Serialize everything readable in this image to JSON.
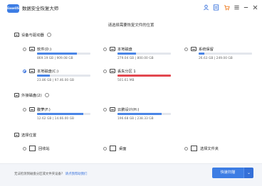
{
  "app": {
    "logo_text": "EaseUS",
    "title": "数据安全恢复大师"
  },
  "titlebar_icons": [
    {
      "name": "user-icon",
      "glyph": "👤",
      "color": "#3b74dd"
    },
    {
      "name": "document-icon",
      "glyph": "▣",
      "color": "#3b74dd"
    },
    {
      "name": "cart-icon",
      "glyph": "⊕",
      "color": "#ef7d22"
    },
    {
      "name": "menu-icon",
      "glyph": "≡",
      "color": "#444"
    },
    {
      "name": "minimize-icon",
      "glyph": "—",
      "color": "#444"
    },
    {
      "name": "close-icon",
      "glyph": "✕",
      "color": "#444"
    }
  ],
  "heading": "请选择需要恢复文件的位置",
  "sections": {
    "local": "设备与驱动器",
    "external": "外接磁盘(2)",
    "location": "选择位置"
  },
  "local_drives": [
    {
      "name": "软件(D:)",
      "size": "869.19 GB | 909.08 GB",
      "used": 0.74,
      "bar_color": "blue",
      "selected": false
    },
    {
      "name": "本地磁盘",
      "size": "279.04 GB | 800.00 GB",
      "used": 0.35,
      "bar_color": "blue",
      "selected": false
    },
    {
      "name": "系统保留",
      "size": "26.63 GB | 249.00 GB",
      "used": 0.11,
      "bar_color": "blue",
      "selected": false
    },
    {
      "name": "本地磁盘(C:)",
      "size": "23.86 GB | 97.46.00 GB",
      "used": 0.24,
      "bar_color": "blue",
      "selected": true
    },
    {
      "name": "丢失分区 1",
      "size": "501.61 MB",
      "used": 1.0,
      "bar_color": "red",
      "selected": false
    }
  ],
  "external_drives": [
    {
      "name": "腹萝(F:)",
      "size": "12.62 GB | 14.66.00 GB",
      "used": 0.86,
      "bar_color": "blue",
      "selected": false
    },
    {
      "name": "云鹏设计(H:)",
      "size": "196.68 GB | 238.33 GB",
      "used": 0.82,
      "bar_color": "blue",
      "selected": false
    }
  ],
  "locations": [
    {
      "name": "回收站",
      "icon": "recycle-bin-icon"
    },
    {
      "name": "桌面",
      "icon": "desktop-icon"
    },
    {
      "name": "选择文件夹",
      "icon": "folder-icon"
    }
  ],
  "footer": {
    "text": "无法检测到磁盘分区或文件夹设备？",
    "link": "请点我帮助我们"
  },
  "scan_button": "快速扫描"
}
